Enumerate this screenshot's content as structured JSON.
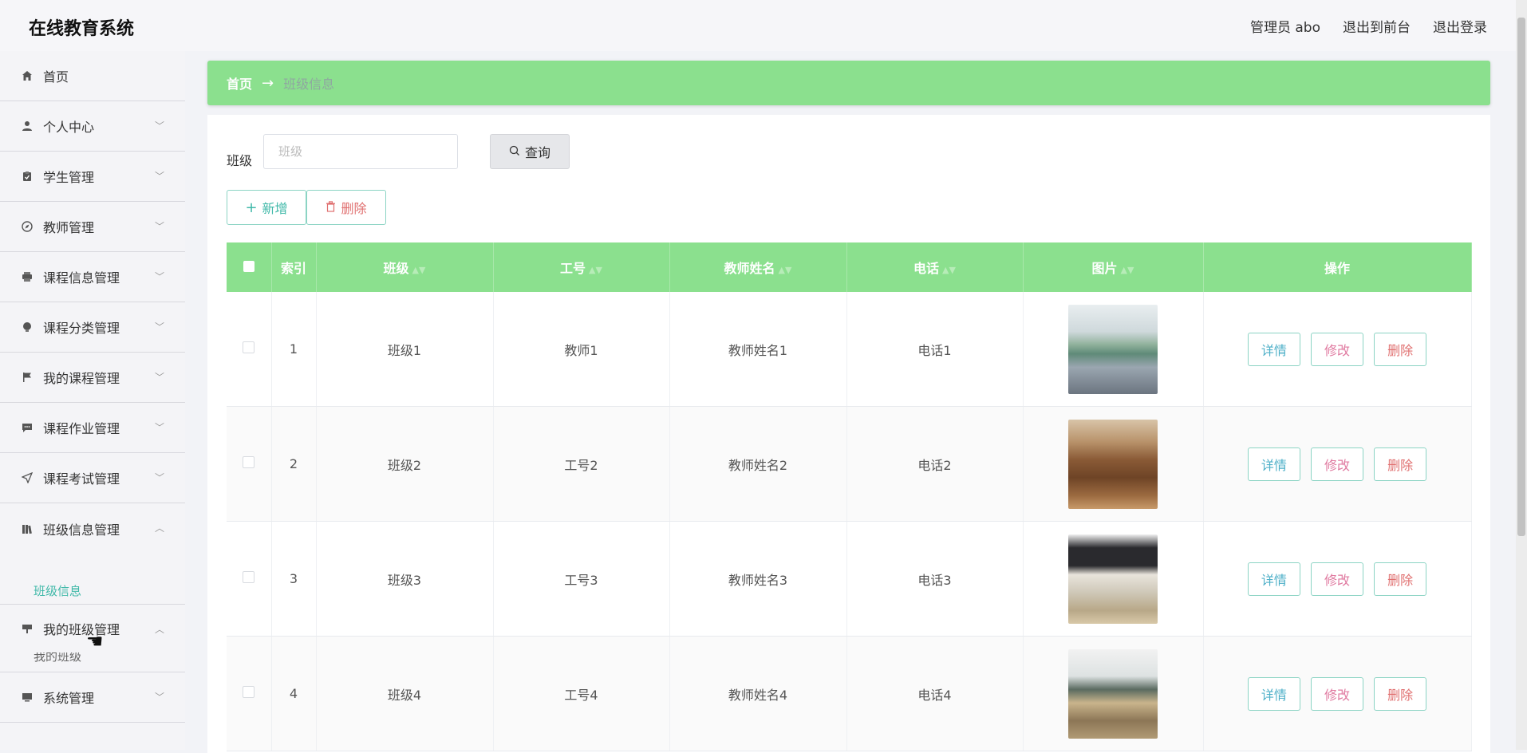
{
  "app": {
    "title": "在线教育系统",
    "user_label": "管理员 abo",
    "front_label": "退出到前台",
    "logout_label": "退出登录"
  },
  "sidebar": {
    "items": [
      {
        "label": "首页",
        "icon": "home-icon"
      },
      {
        "label": "个人中心",
        "icon": "user-icon"
      },
      {
        "label": "学生管理",
        "icon": "clipboard-icon"
      },
      {
        "label": "教师管理",
        "icon": "compass-icon"
      },
      {
        "label": "课程信息管理",
        "icon": "printer-icon"
      },
      {
        "label": "课程分类管理",
        "icon": "bulb-icon"
      },
      {
        "label": "我的课程管理",
        "icon": "flag-icon"
      },
      {
        "label": "课程作业管理",
        "icon": "chat-icon"
      },
      {
        "label": "课程考试管理",
        "icon": "send-icon"
      },
      {
        "label": "班级信息管理",
        "icon": "book-icon"
      },
      {
        "label": "我的班级管理",
        "icon": "easel-icon"
      },
      {
        "label": "系统管理",
        "icon": "monitor-icon"
      }
    ],
    "active_sub": "班级信息",
    "partial_sub": "我的班级"
  },
  "breadcrumb": {
    "home": "首页",
    "arrow": "→",
    "current": "班级信息"
  },
  "search": {
    "label": "班级",
    "placeholder": "班级",
    "button": "查询"
  },
  "actions": {
    "add": "新增",
    "delete": "删除"
  },
  "table": {
    "headers": [
      "索引",
      "班级",
      "工号",
      "教师姓名",
      "电话",
      "图片",
      "操作"
    ],
    "rows": [
      {
        "index": "1",
        "class": "班级1",
        "id": "教师1",
        "name": "教师姓名1",
        "phone": "电话1"
      },
      {
        "index": "2",
        "class": "班级2",
        "id": "工号2",
        "name": "教师姓名2",
        "phone": "电话2"
      },
      {
        "index": "3",
        "class": "班级3",
        "id": "工号3",
        "name": "教师姓名3",
        "phone": "电话3"
      },
      {
        "index": "4",
        "class": "班级4",
        "id": "工号4",
        "name": "教师姓名4",
        "phone": "电话4"
      }
    ],
    "row_actions": {
      "detail": "详情",
      "edit": "修改",
      "remove": "删除"
    }
  },
  "colors": {
    "accent_green": "#8be08e",
    "teal": "#3fb8a8"
  }
}
